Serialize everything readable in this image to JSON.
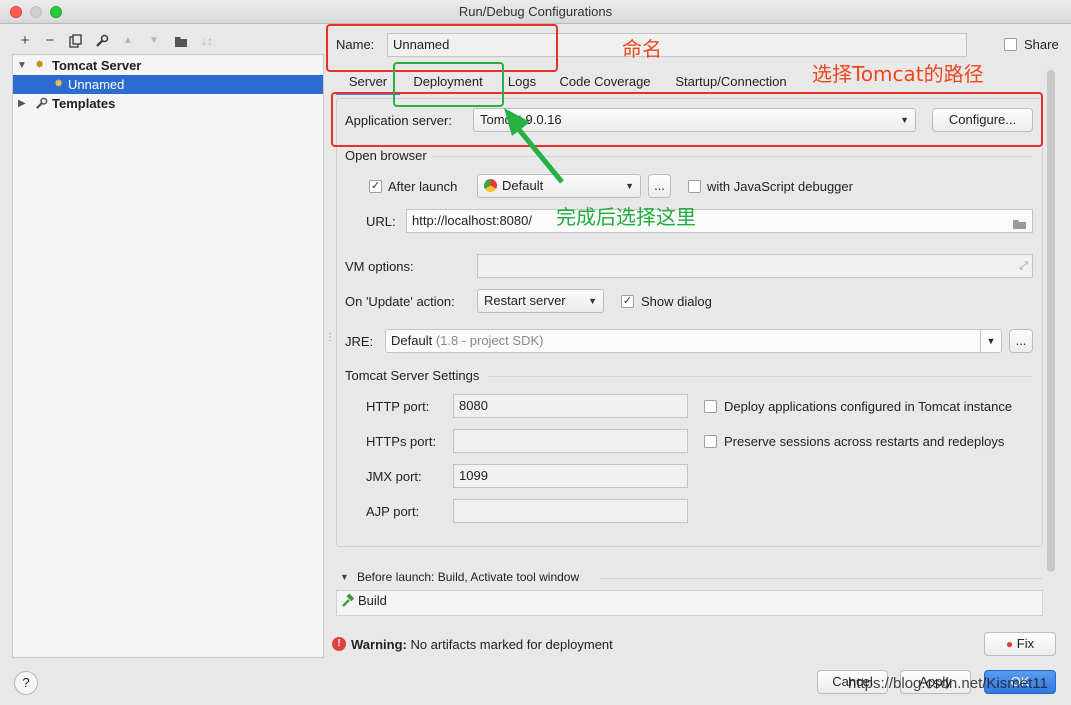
{
  "window": {
    "title": "Run/Debug Configurations"
  },
  "toolbar": {
    "icons": [
      "plus-icon",
      "minus-icon",
      "copy-icon",
      "wrench-icon",
      "arrow-up-icon",
      "arrow-down-icon",
      "folder-add-icon",
      "sort-icon"
    ]
  },
  "tree": {
    "group": "Tomcat Server",
    "item": "Unnamed",
    "templates": "Templates"
  },
  "name": {
    "label": "Name:",
    "value": "Unnamed"
  },
  "share": {
    "label": "Share"
  },
  "tabs": [
    {
      "label": "Server"
    },
    {
      "label": "Deployment"
    },
    {
      "label": "Logs"
    },
    {
      "label": "Code Coverage"
    },
    {
      "label": "Startup/Connection"
    }
  ],
  "app_server": {
    "label": "Application server:",
    "value": "Tomcat 9.0.16",
    "configure": "Configure..."
  },
  "open_browser": {
    "section": "Open browser",
    "after_launch": "After launch",
    "browser": "Default",
    "more": "...",
    "js_debugger": "with JavaScript debugger",
    "url_label": "URL:",
    "url_value": "http://localhost:8080/"
  },
  "vm_options": {
    "label": "VM options:",
    "value": ""
  },
  "on_update": {
    "label": "On 'Update' action:",
    "value": "Restart server",
    "show_dialog": "Show dialog"
  },
  "jre": {
    "label": "JRE:",
    "value_main": "Default",
    "value_hint": " (1.8 - project SDK)",
    "more": "..."
  },
  "tomcat_settings": {
    "section": "Tomcat Server Settings",
    "http_label": "HTTP port:",
    "http_value": "8080",
    "https_label": "HTTPs port:",
    "https_value": "",
    "jmx_label": "JMX port:",
    "jmx_value": "1099",
    "ajp_label": "AJP port:",
    "ajp_value": "",
    "deploy_apps": "Deploy applications configured in Tomcat instance",
    "preserve_sessions": "Preserve sessions across restarts and redeploys"
  },
  "before_launch": {
    "header": "Before launch: Build, Activate tool window",
    "item": "Build"
  },
  "warning": {
    "bold": "Warning:",
    "text": " No artifacts marked for deployment",
    "fix": "Fix"
  },
  "footer": {
    "help": "?",
    "cancel": "Cancel",
    "apply": "Apply",
    "ok": "OK",
    "watermark": "https://blog.csdn.net/Kismet11"
  },
  "annotations": {
    "name_note": "命名",
    "tomcat_note": "选择Tomcat的路径",
    "deploy_note": "完成后选择这里"
  },
  "colors": {
    "selection": "#2c6cd1",
    "annotation_red": "#e8302a",
    "annotation_green": "#27b043"
  }
}
